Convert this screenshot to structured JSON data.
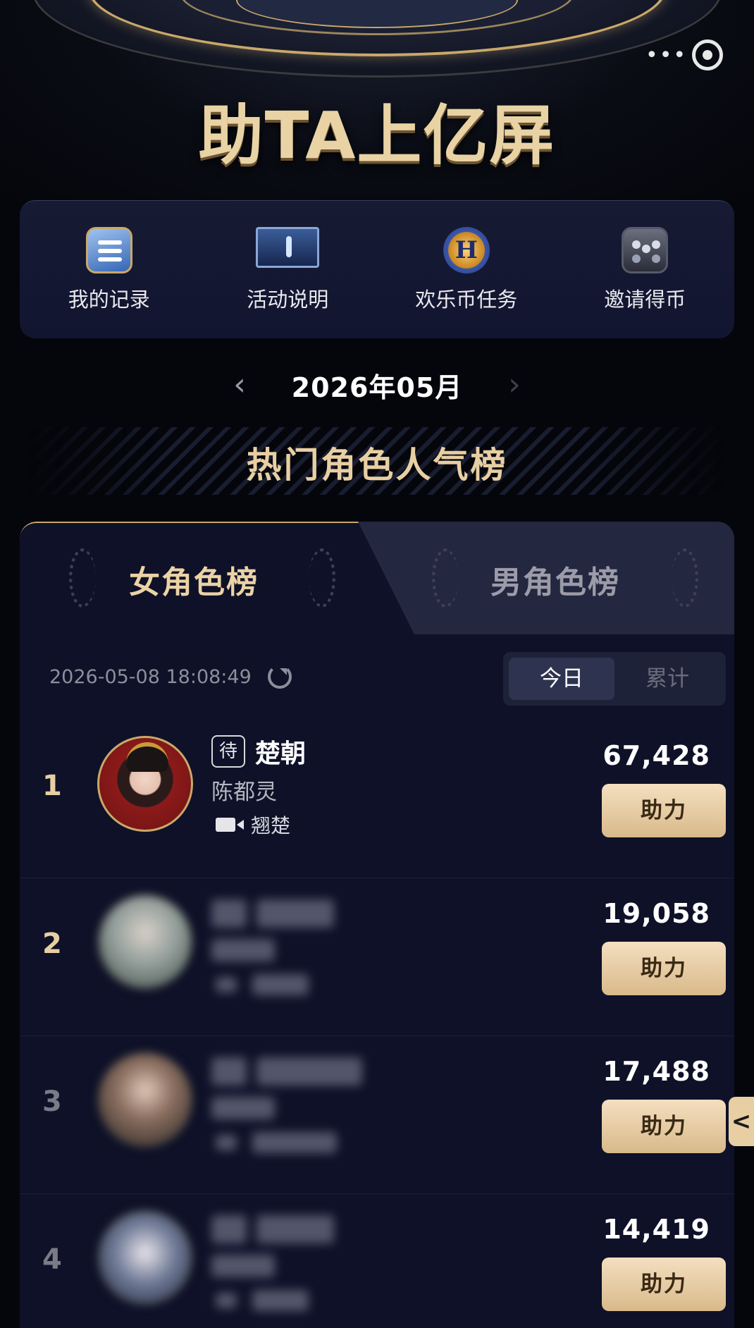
{
  "header": {
    "title": "助TA上亿屏",
    "menu_dots": "•••"
  },
  "quick_menu": [
    {
      "label": "我的记录",
      "icon": "record-icon"
    },
    {
      "label": "活动说明",
      "icon": "screen-icon"
    },
    {
      "label": "欢乐币任务",
      "icon": "coin-icon",
      "glyph": "H"
    },
    {
      "label": "邀请得币",
      "icon": "invite-icon"
    }
  ],
  "month_nav": {
    "prev": "‹",
    "label": "2026年05月",
    "next": "›"
  },
  "section_title": "热门角色人气榜",
  "tabs": {
    "female": "女角色榜",
    "male": "男角色榜",
    "active": "female"
  },
  "meta": {
    "timestamp": "2026-05-08 18:08:49",
    "toggle_today": "今日",
    "toggle_total": "累计",
    "toggle_active": "today"
  },
  "ranking": [
    {
      "rank": "1",
      "badge": "待",
      "role": "楚朝",
      "actor": "陈都灵",
      "drama": "翘楚",
      "score": "67,428",
      "button": "助力",
      "blurred": false
    },
    {
      "rank": "2",
      "badge": "",
      "role": "",
      "actor": "",
      "drama": "",
      "score": "19,058",
      "button": "助力",
      "blurred": true
    },
    {
      "rank": "3",
      "badge": "",
      "role": "",
      "actor": "",
      "drama": "",
      "score": "17,488",
      "button": "助力",
      "blurred": true
    },
    {
      "rank": "4",
      "badge": "",
      "role": "",
      "actor": "",
      "drama": "",
      "score": "14,419",
      "button": "助力",
      "blurred": true
    }
  ],
  "side_tab": "<",
  "colors": {
    "gold": "#e8cfa3",
    "panel": "#0e1128",
    "button_top": "#f4dfc0",
    "button_bottom": "#d9b98a"
  }
}
